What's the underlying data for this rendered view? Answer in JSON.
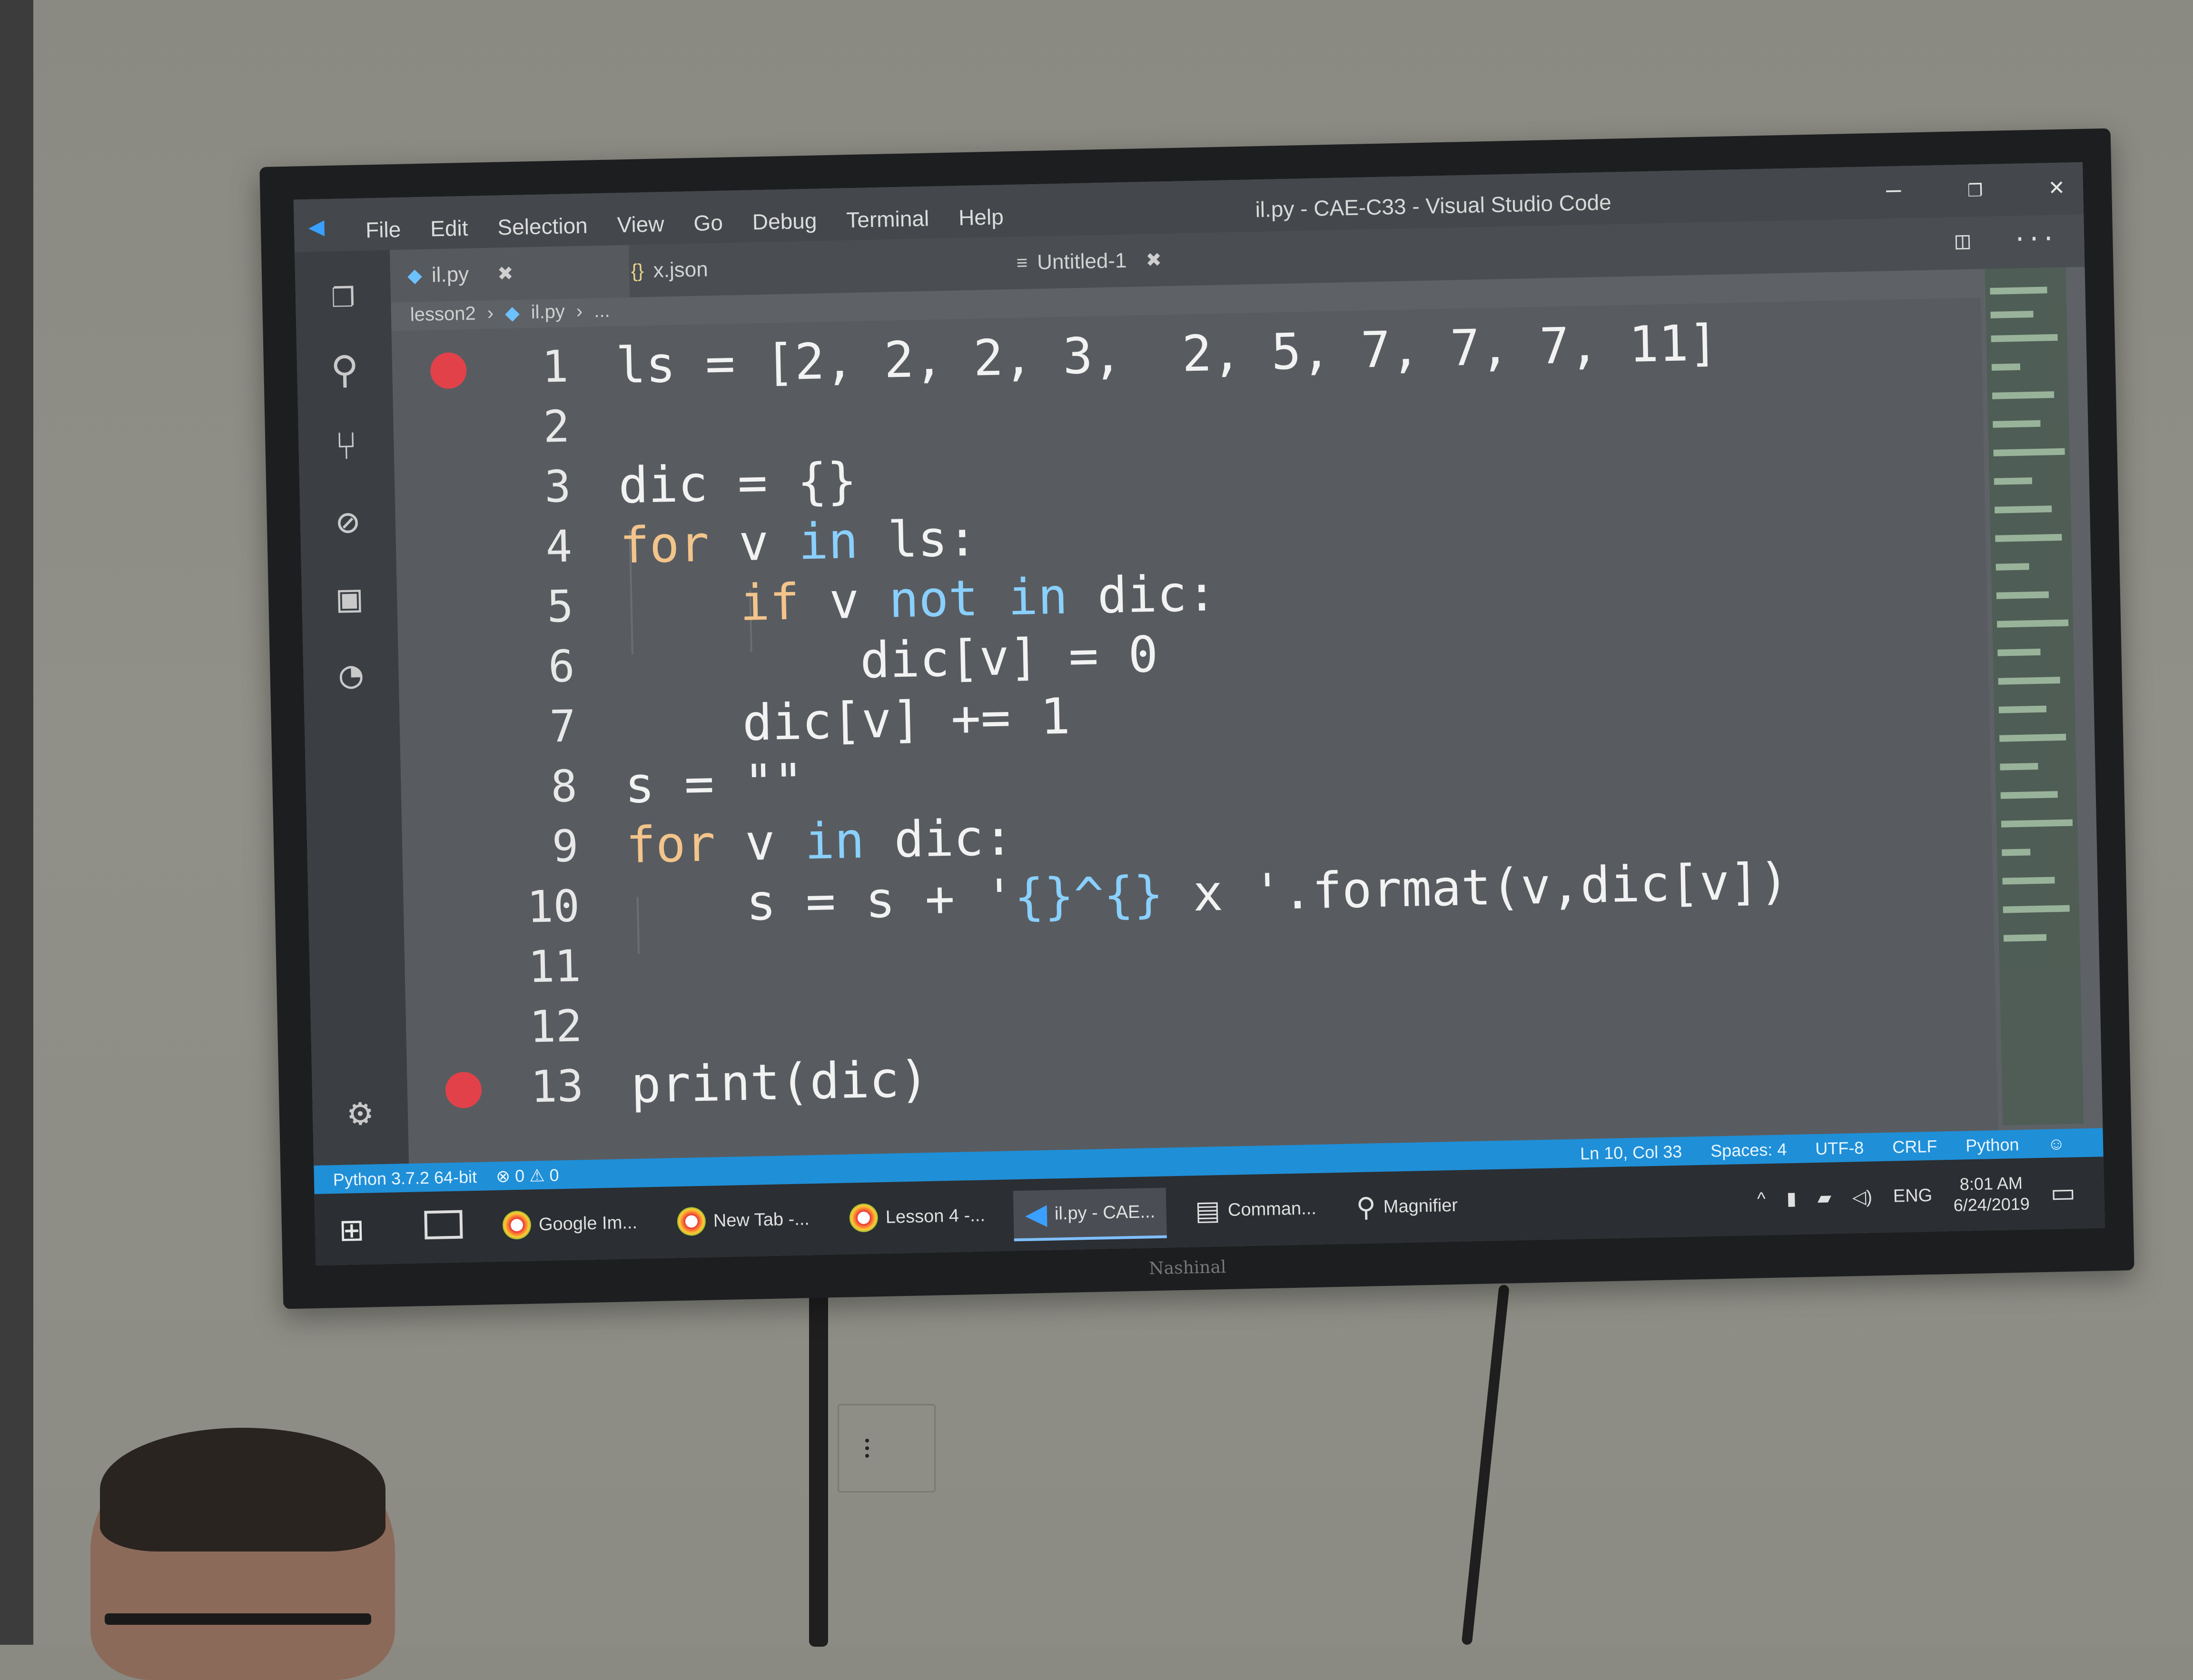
{
  "window": {
    "title": "il.py - CAE-C33 - Visual Studio Code",
    "menu": [
      "File",
      "Edit",
      "Selection",
      "View",
      "Go",
      "Debug",
      "Terminal",
      "Help"
    ],
    "controls": {
      "minimize": "—",
      "restore": "❐",
      "close": "✕"
    }
  },
  "tabs": [
    {
      "label": "il.py",
      "icon": "◆",
      "close": "✖"
    },
    {
      "label": "x.json",
      "icon": "{}",
      "close": ""
    },
    {
      "label": "Untitled-1",
      "icon": "≡",
      "close": "✖"
    }
  ],
  "editor_actions": {
    "split": "◫",
    "more": "···"
  },
  "breadcrumb": {
    "folder": "lesson2",
    "sep1": "›",
    "file_icon": "◆",
    "file": "il.py",
    "sep2": "›",
    "symbol": "..."
  },
  "code": {
    "lines": [
      {
        "n": "1",
        "breakpoint": true
      },
      {
        "n": "2",
        "breakpoint": false
      },
      {
        "n": "3",
        "breakpoint": false
      },
      {
        "n": "4",
        "breakpoint": false
      },
      {
        "n": "5",
        "breakpoint": false
      },
      {
        "n": "6",
        "breakpoint": false
      },
      {
        "n": "7",
        "breakpoint": false
      },
      {
        "n": "8",
        "breakpoint": false
      },
      {
        "n": "9",
        "breakpoint": false
      },
      {
        "n": "10",
        "breakpoint": false
      },
      {
        "n": "11",
        "breakpoint": false
      },
      {
        "n": "12",
        "breakpoint": false
      },
      {
        "n": "13",
        "breakpoint": true
      }
    ],
    "l1": "ls = [2, 2, 2, 3,  2, 5, 7, 7, 7, 11]",
    "l3": "dic = {}",
    "l4_kw": "for",
    "l4_mid": " v ",
    "l4_in": "in",
    "l4_end": " ls:",
    "l5_if": "if",
    "l5_v": " v ",
    "l5_not": "not",
    "l5_sp": " ",
    "l5_in": "in",
    "l5_end": " dic:",
    "l6": "dic[v] = 0",
    "l7": "dic[v] += 1",
    "l8": "s = \"\"",
    "l9_kw": "for",
    "l9_mid": " v ",
    "l9_in": "in",
    "l9_end": " dic:",
    "l10_a": "s = s + '",
    "l10_b": "{}^{}",
    "l10_c": " x '.format(v,dic[v])",
    "l13": "print(dic)"
  },
  "statusbar": {
    "interpreter": "Python 3.7.2 64-bit",
    "problems": "⊗ 0 ⚠ 0",
    "position": "Ln 10, Col 33",
    "spaces": "Spaces: 4",
    "encoding": "UTF-8",
    "eol": "CRLF",
    "language": "Python",
    "feedback": "☺"
  },
  "taskbar": {
    "start": "⊞",
    "items": [
      {
        "label": "Google Im..."
      },
      {
        "label": "New Tab -..."
      },
      {
        "label": "Lesson 4 -..."
      },
      {
        "label": "il.py - CAE..."
      },
      {
        "label": "Comman..."
      },
      {
        "label": "Magnifier"
      }
    ],
    "tray": {
      "up": "^",
      "lang": "ENG",
      "time": "8:01 AM",
      "date": "6/24/2019",
      "notify": "▭"
    }
  },
  "monitor_brand": "Nashinal",
  "colors": {
    "accent": "#1f8fd8",
    "keyword": "#f3c48b",
    "keyword2": "#8ad0ff",
    "breakpoint": "#e2414a"
  }
}
